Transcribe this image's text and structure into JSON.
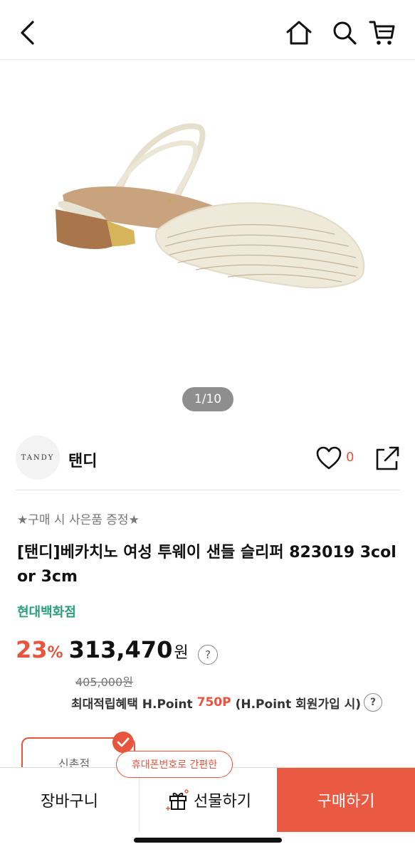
{
  "header": {
    "back_icon": "chevron-left-icon",
    "home_icon": "home-icon",
    "search_icon": "search-icon",
    "cart_icon": "cart-icon"
  },
  "gallery": {
    "pager": "1/10"
  },
  "brand": {
    "logo_text": "TANDY",
    "name": "탠디",
    "like_count": "0"
  },
  "product": {
    "promo": "★구매 시 사은품 증정★",
    "title": "[탠디]베카치노 여성 투웨이 샌들 슬리퍼 823019 3color 3cm",
    "store": "현대백화점",
    "discount": "23",
    "discount_unit": "%",
    "price": "313,470",
    "price_unit": "원",
    "original_price": "405,000원",
    "points_label": "최대적립혜택 H.Point",
    "points_value": "750P",
    "points_note": "(H.Point 회원가입 시)",
    "help_glyph": "?"
  },
  "options": {
    "first_option_label": "신촌점"
  },
  "bottom": {
    "cart_label": "장바구니",
    "gift_label": "선물하기",
    "buy_label": "구매하기",
    "tooltip": "휴대폰번호로 간편한"
  },
  "colors": {
    "accent": "#e8553e",
    "store_green": "#2a9d7a",
    "buy_bg": "#ea5a43"
  }
}
